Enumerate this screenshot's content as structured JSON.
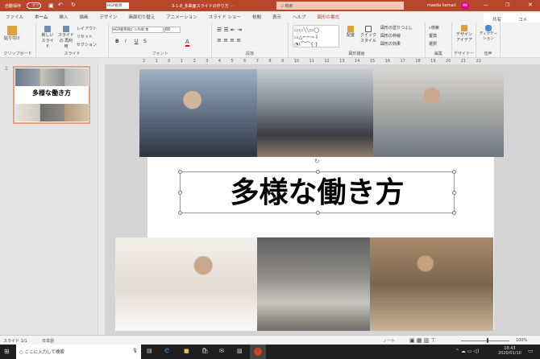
{
  "titlebar": {
    "autosave": "自動保存",
    "autosave_state": "オフ",
    "font_box": "HGP創英",
    "doc_title": "3-1-8_多曲面スライドの作り方 ···",
    "search_placeholder": "検索",
    "user": "maeda kamari",
    "avatar": "MK"
  },
  "tabs": [
    "ファイル",
    "ホーム",
    "挿入",
    "描画",
    "デザイン",
    "画面切り替え",
    "アニメーション",
    "スライド ショー",
    "校閲",
    "表示",
    "ヘルプ",
    "図形の書式"
  ],
  "share": "共有",
  "comment": "コメント",
  "ribbon": {
    "clipboard": {
      "label": "クリップボード",
      "paste": "貼り付け"
    },
    "slides": {
      "label": "スライド",
      "new_slide": "新しい スライド",
      "reuse": "スライドの 再利用",
      "layout": "レイアウト",
      "reset": "リセット",
      "section": "セクション"
    },
    "font": {
      "label": "フォント",
      "font_name": "HGP創英角ｺﾞｼｯｸUB 本",
      "font_size": "66",
      "bold": "B",
      "italic": "I",
      "underline": "U",
      "strike": "S"
    },
    "paragraph": {
      "label": "段落"
    },
    "drawing": {
      "label": "図形描画",
      "arrange": "配置",
      "quick_style": "クイック スタイル",
      "fill": "図形の塗りつぶし",
      "outline": "図形の枠線",
      "effects": "図形の効果"
    },
    "editing": {
      "label": "編集",
      "find": "検索",
      "replace": "置換",
      "select": "選択"
    },
    "designer": {
      "label": "デザイナー",
      "ideas": "デザイン アイデア"
    },
    "voice": {
      "label": "音声",
      "dictate": "ディクテーション"
    }
  },
  "ruler": [
    "2",
    "1",
    "0",
    "1",
    "2",
    "3",
    "4",
    "5",
    "6",
    "7",
    "8",
    "9",
    "10",
    "11",
    "12",
    "13",
    "14",
    "15",
    "16",
    "17",
    "18",
    "19",
    "20",
    "21",
    "22"
  ],
  "thumbnail": {
    "number": "1",
    "title": "多様な働き方"
  },
  "slide": {
    "title": "多様な働き方"
  },
  "status": {
    "slide": "スライド 1/1",
    "language": "日本語",
    "notes": "ノート",
    "zoom": "100%"
  },
  "taskbar": {
    "search": "ここに入力して検索",
    "time": "18:43",
    "date": "2020/01/10"
  }
}
